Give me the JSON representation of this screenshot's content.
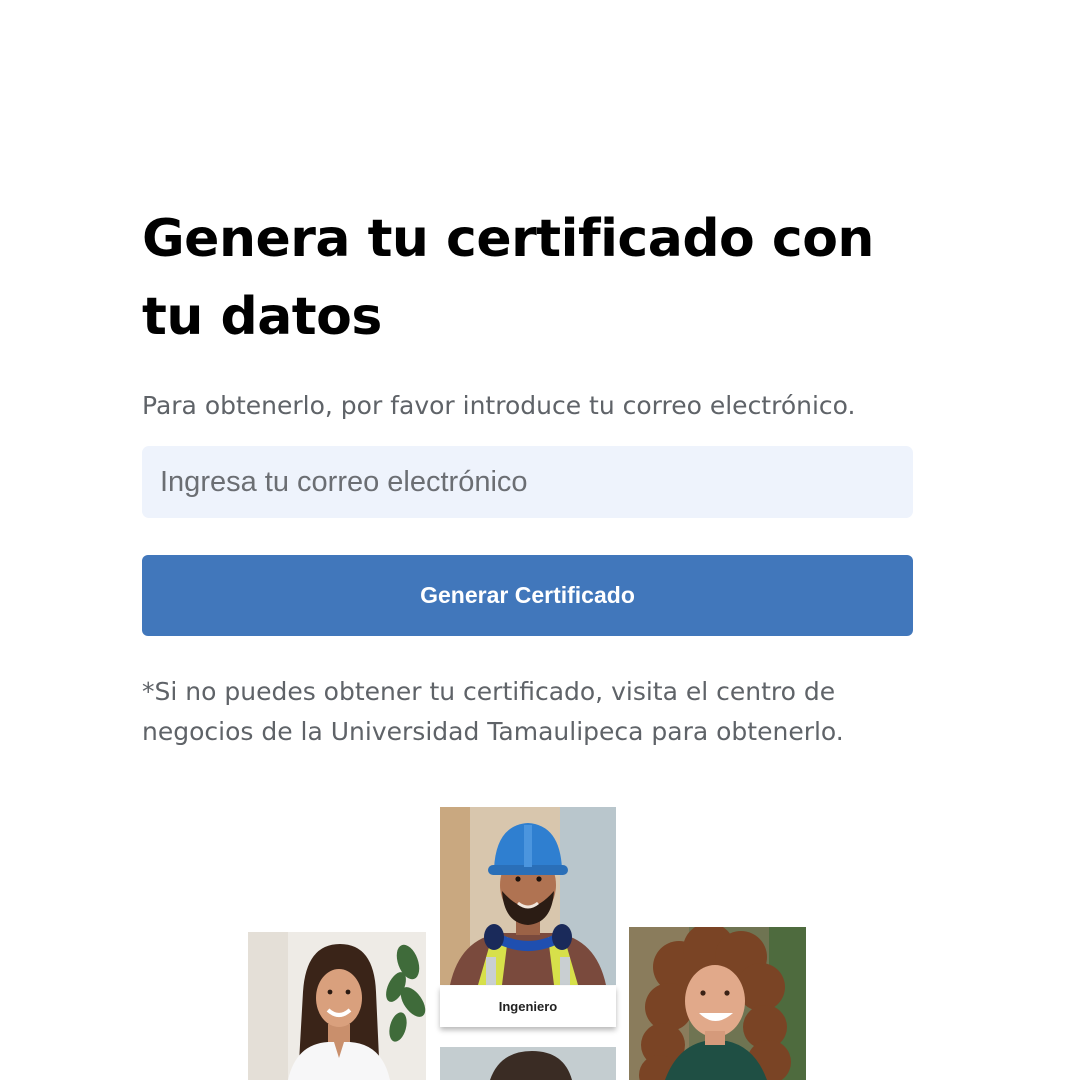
{
  "form": {
    "title": "Genera tu certificado con tu datos",
    "subtitle": "Para obtenerlo, por favor introduce tu correo electrónico.",
    "email_placeholder": "Ingresa tu correo electrónico",
    "email_value": "",
    "submit_label": "Generar Certificado",
    "help_text": "*Si no puedes obtener tu certificado, visita el centro de negocios de la Universidad Tamaulipeca para obtenerlo."
  },
  "collage": {
    "center_card_label": "Ingeniero"
  },
  "colors": {
    "primary_button": "#4177bb",
    "input_background": "#eef3fc",
    "text_muted": "#5f6368"
  }
}
